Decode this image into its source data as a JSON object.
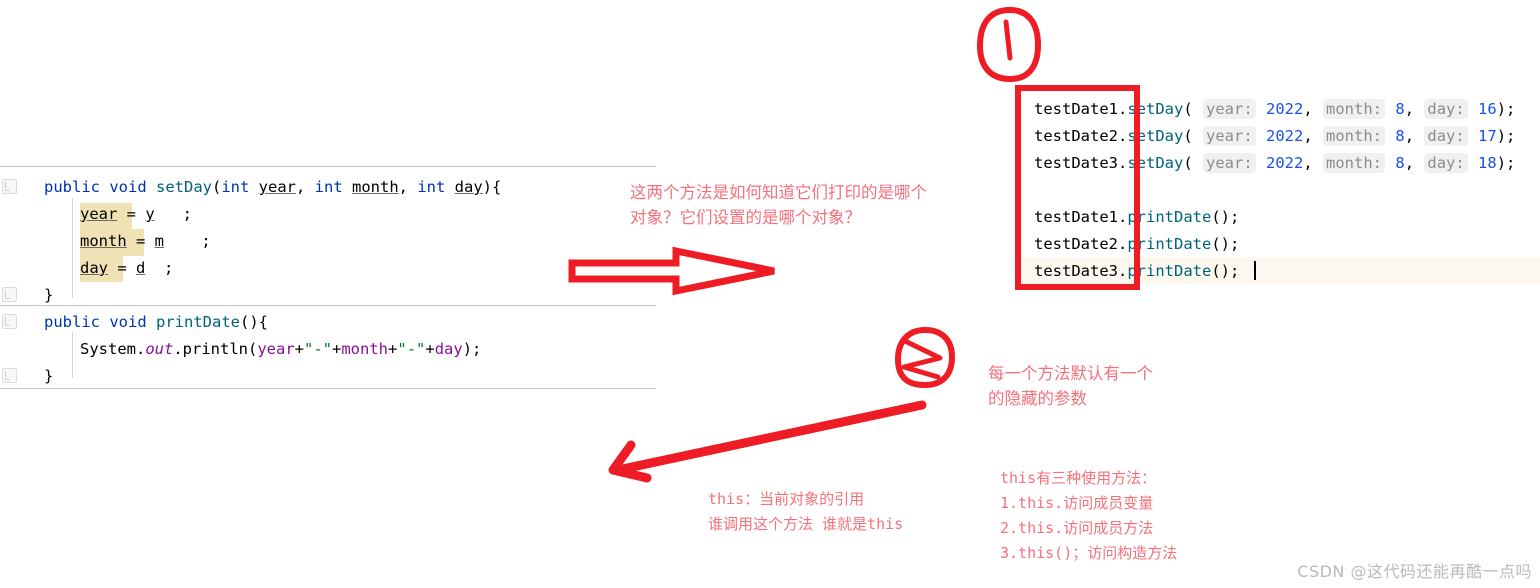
{
  "left_editor": {
    "gutter_icon_name": "method-gutter-icon",
    "lines": [
      {
        "indent": 0,
        "tokens": [
          {
            "t": "public ",
            "c": "kw"
          },
          {
            "t": "void ",
            "c": "kw"
          },
          {
            "t": "setDay",
            "c": "method"
          },
          {
            "t": "(",
            "c": ""
          },
          {
            "t": "int ",
            "c": "kw"
          },
          {
            "t": "year",
            "c": "param"
          },
          {
            "t": ", ",
            "c": ""
          },
          {
            "t": "int ",
            "c": "kw"
          },
          {
            "t": "month",
            "c": "param"
          },
          {
            "t": ", ",
            "c": ""
          },
          {
            "t": "int ",
            "c": "kw"
          },
          {
            "t": "day",
            "c": "param"
          },
          {
            "t": "){",
            "c": ""
          }
        ]
      },
      {
        "indent": 1,
        "hl": true,
        "tokens": [
          {
            "t": "year",
            "c": "param"
          },
          {
            "t": " = ",
            "c": ""
          },
          {
            "t": "y",
            "c": "param"
          },
          {
            "t": "   ;",
            "c": ""
          }
        ]
      },
      {
        "indent": 1,
        "hl": true,
        "tokens": [
          {
            "t": "month",
            "c": "param"
          },
          {
            "t": " = ",
            "c": ""
          },
          {
            "t": "m",
            "c": "param"
          },
          {
            "t": "    ;",
            "c": ""
          }
        ]
      },
      {
        "indent": 1,
        "hl": true,
        "tokens": [
          {
            "t": "day",
            "c": "param"
          },
          {
            "t": " = ",
            "c": ""
          },
          {
            "t": "d",
            "c": "param"
          },
          {
            "t": "  ;",
            "c": ""
          }
        ]
      },
      {
        "indent": 0,
        "tokens": [
          {
            "t": "}",
            "c": ""
          }
        ]
      },
      {
        "indent": 0,
        "tokens": [
          {
            "t": "public ",
            "c": "kw"
          },
          {
            "t": "void ",
            "c": "kw"
          },
          {
            "t": "printDate",
            "c": "method"
          },
          {
            "t": "(){",
            "c": ""
          }
        ]
      },
      {
        "indent": 1,
        "tokens": [
          {
            "t": "System",
            "c": ""
          },
          {
            "t": ".",
            "c": ""
          },
          {
            "t": "out",
            "c": "ital"
          },
          {
            "t": ".println(",
            "c": ""
          },
          {
            "t": "year",
            "c": "field"
          },
          {
            "t": "+",
            "c": ""
          },
          {
            "t": "\"-\"",
            "c": "str"
          },
          {
            "t": "+",
            "c": ""
          },
          {
            "t": "month",
            "c": "field"
          },
          {
            "t": "+",
            "c": ""
          },
          {
            "t": "\"-\"",
            "c": "str"
          },
          {
            "t": "+",
            "c": ""
          },
          {
            "t": "day",
            "c": "field"
          },
          {
            "t": ");",
            "c": ""
          }
        ]
      },
      {
        "indent": 0,
        "tokens": [
          {
            "t": "}",
            "c": ""
          }
        ]
      }
    ],
    "plain_lines": [
      "public void setDay(int year, int month, int day){",
      "    year = y   ;",
      "    month = m    ;",
      "    day = d  ;",
      "}",
      "public void printDate(){",
      "    System.out.println(year+\"-\"+month+\"-\"+day);",
      "}"
    ]
  },
  "right_editor": {
    "lines": [
      {
        "tokens": [
          {
            "t": "testDate1",
            "c": ""
          },
          {
            "t": ".",
            "c": ""
          },
          {
            "t": "setDay",
            "c": "method"
          },
          {
            "t": "( ",
            "c": ""
          },
          {
            "t": "year:",
            "c": "hint"
          },
          {
            "t": " ",
            "c": ""
          },
          {
            "t": "2022",
            "c": "num"
          },
          {
            "t": ", ",
            "c": ""
          },
          {
            "t": "month:",
            "c": "hint"
          },
          {
            "t": " ",
            "c": ""
          },
          {
            "t": "8",
            "c": "num"
          },
          {
            "t": ", ",
            "c": ""
          },
          {
            "t": "day:",
            "c": "hint"
          },
          {
            "t": " ",
            "c": ""
          },
          {
            "t": "16",
            "c": "num"
          },
          {
            "t": ");",
            "c": ""
          }
        ]
      },
      {
        "tokens": [
          {
            "t": "testDate2",
            "c": ""
          },
          {
            "t": ".",
            "c": ""
          },
          {
            "t": "setDay",
            "c": "method"
          },
          {
            "t": "( ",
            "c": ""
          },
          {
            "t": "year:",
            "c": "hint"
          },
          {
            "t": " ",
            "c": ""
          },
          {
            "t": "2022",
            "c": "num"
          },
          {
            "t": ", ",
            "c": ""
          },
          {
            "t": "month:",
            "c": "hint"
          },
          {
            "t": " ",
            "c": ""
          },
          {
            "t": "8",
            "c": "num"
          },
          {
            "t": ", ",
            "c": ""
          },
          {
            "t": "day:",
            "c": "hint"
          },
          {
            "t": " ",
            "c": ""
          },
          {
            "t": "17",
            "c": "num"
          },
          {
            "t": ");",
            "c": ""
          }
        ]
      },
      {
        "tokens": [
          {
            "t": "testDate3",
            "c": ""
          },
          {
            "t": ".",
            "c": ""
          },
          {
            "t": "setDay",
            "c": "method"
          },
          {
            "t": "( ",
            "c": ""
          },
          {
            "t": "year:",
            "c": "hint"
          },
          {
            "t": " ",
            "c": ""
          },
          {
            "t": "2022",
            "c": "num"
          },
          {
            "t": ", ",
            "c": ""
          },
          {
            "t": "month:",
            "c": "hint"
          },
          {
            "t": " ",
            "c": ""
          },
          {
            "t": "8",
            "c": "num"
          },
          {
            "t": ", ",
            "c": ""
          },
          {
            "t": "day:",
            "c": "hint"
          },
          {
            "t": " ",
            "c": ""
          },
          {
            "t": "18",
            "c": "num"
          },
          {
            "t": ");",
            "c": ""
          }
        ]
      },
      {
        "tokens": [
          {
            "t": " ",
            "c": ""
          }
        ]
      },
      {
        "tokens": [
          {
            "t": "testDate1",
            "c": ""
          },
          {
            "t": ".",
            "c": ""
          },
          {
            "t": "printDate",
            "c": "method"
          },
          {
            "t": "();",
            "c": ""
          }
        ]
      },
      {
        "tokens": [
          {
            "t": "testDate2",
            "c": ""
          },
          {
            "t": ".",
            "c": ""
          },
          {
            "t": "printDate",
            "c": "method"
          },
          {
            "t": "();",
            "c": ""
          }
        ]
      },
      {
        "tokens": [
          {
            "t": "testDate3",
            "c": ""
          },
          {
            "t": ".",
            "c": ""
          },
          {
            "t": "printDate",
            "c": "method"
          },
          {
            "t": "();",
            "c": ""
          }
        ]
      }
    ],
    "plain_lines": [
      "testDate1.setDay( year: 2022, month: 8, day: 16);",
      "testDate2.setDay( year: 2022, month: 8, day: 17);",
      "testDate3.setDay( year: 2022, month: 8, day: 18);",
      "",
      "testDate1.printDate();",
      "testDate2.printDate();",
      "testDate3.printDate();"
    ]
  },
  "annotations": {
    "question_note": "这两个方法是如何知道它们打印的是哪个\n对象？它们设置的是哪个对象？",
    "hidden_param_note": "每一个方法默认有一个\n的隐藏的参数",
    "this_ref_note": "this：当前对象的引用\n谁调用这个方法 谁就是this",
    "this_usage_note": "this有三种使用方法：\n1.this.访问成员变量\n2.this.访问成员方法\n3.this()；访问构造方法",
    "marker_one": "1",
    "marker_two": "2"
  },
  "colors": {
    "annotation_red": "#ee1c25",
    "note_pink": "#f4717c",
    "keyword_blue": "#0033b3",
    "number_blue": "#1750eb",
    "method_teal": "#00627a",
    "field_purple": "#871094",
    "string_green": "#067d17",
    "highlight_tan": "#f0e2b5",
    "caret_line": "#fcf8ef",
    "watermark_gray": "#b9b9b9"
  },
  "watermark": {
    "text": "CSDN @这代码还能再酷一点吗"
  }
}
